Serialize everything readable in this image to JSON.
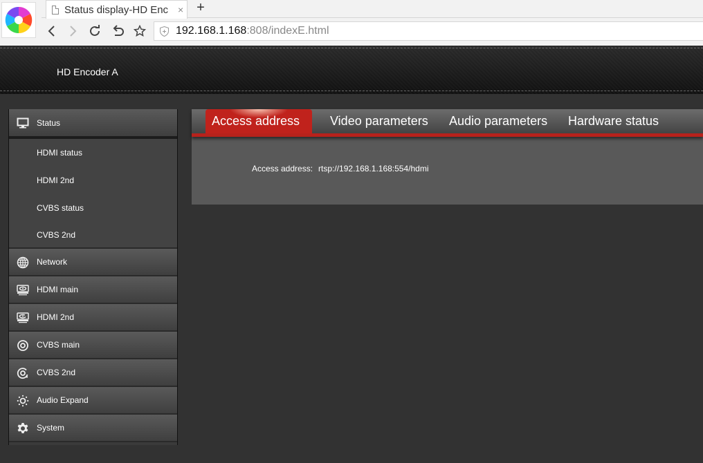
{
  "browser": {
    "tab_title": "Status display-HD Enc",
    "tab_close": "×",
    "new_tab": "+",
    "url_host": "192.168.1.168",
    "url_rest": ":808/indexE.html"
  },
  "header": {
    "device_name": "HD Encoder  A"
  },
  "sidebar": {
    "items": [
      {
        "label": "Status",
        "icon": "monitor-icon",
        "expanded": true,
        "children": [
          {
            "label": "HDMI status"
          },
          {
            "label": "HDMI 2nd"
          },
          {
            "label": "CVBS status"
          },
          {
            "label": "CVBS 2nd"
          }
        ]
      },
      {
        "label": "Network",
        "icon": "globe-icon"
      },
      {
        "label": "HDMI main",
        "icon": "hdmi-main-icon"
      },
      {
        "label": "HDMI 2nd",
        "icon": "hdmi-2nd-icon"
      },
      {
        "label": "CVBS main",
        "icon": "cvbs-main-icon"
      },
      {
        "label": "CVBS 2nd",
        "icon": "cvbs-2nd-icon"
      },
      {
        "label": "Audio Expand",
        "icon": "audio-expand-icon"
      },
      {
        "label": "System",
        "icon": "gear-icon"
      }
    ]
  },
  "main": {
    "tabs": [
      {
        "label": "Access address",
        "active": true
      },
      {
        "label": "Video parameters",
        "active": false
      },
      {
        "label": "Audio parameters",
        "active": false
      },
      {
        "label": "Hardware status",
        "active": false
      }
    ],
    "access": {
      "label": "Access address:",
      "value": "rtsp://192.168.1.168:554/hdmi"
    }
  },
  "colors": {
    "accent": "#c0221c",
    "panel": "#595959",
    "background": "#323232"
  }
}
